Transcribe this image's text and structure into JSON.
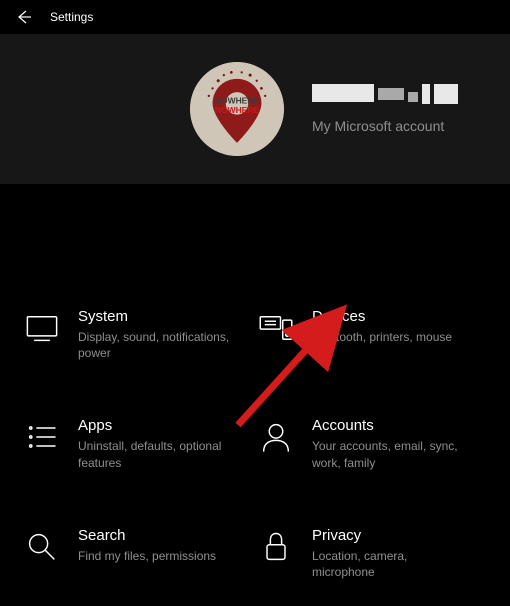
{
  "titlebar": {
    "title": "Settings"
  },
  "header": {
    "account_link": "My Microsoft account"
  },
  "tiles": [
    {
      "key": "system",
      "title": "System",
      "desc": "Display, sound, notifications, power"
    },
    {
      "key": "devices",
      "title": "Devices",
      "desc": "Bluetooth, printers, mouse"
    },
    {
      "key": "apps",
      "title": "Apps",
      "desc": "Uninstall, defaults, optional features"
    },
    {
      "key": "accounts",
      "title": "Accounts",
      "desc": "Your accounts, email, sync, work, family"
    },
    {
      "key": "search",
      "title": "Search",
      "desc": "Find my files, permissions"
    },
    {
      "key": "privacy",
      "title": "Privacy",
      "desc": "Location, camera, microphone"
    }
  ],
  "annotation": {
    "arrow_color": "#d51c1c",
    "arrow_target": "devices"
  }
}
